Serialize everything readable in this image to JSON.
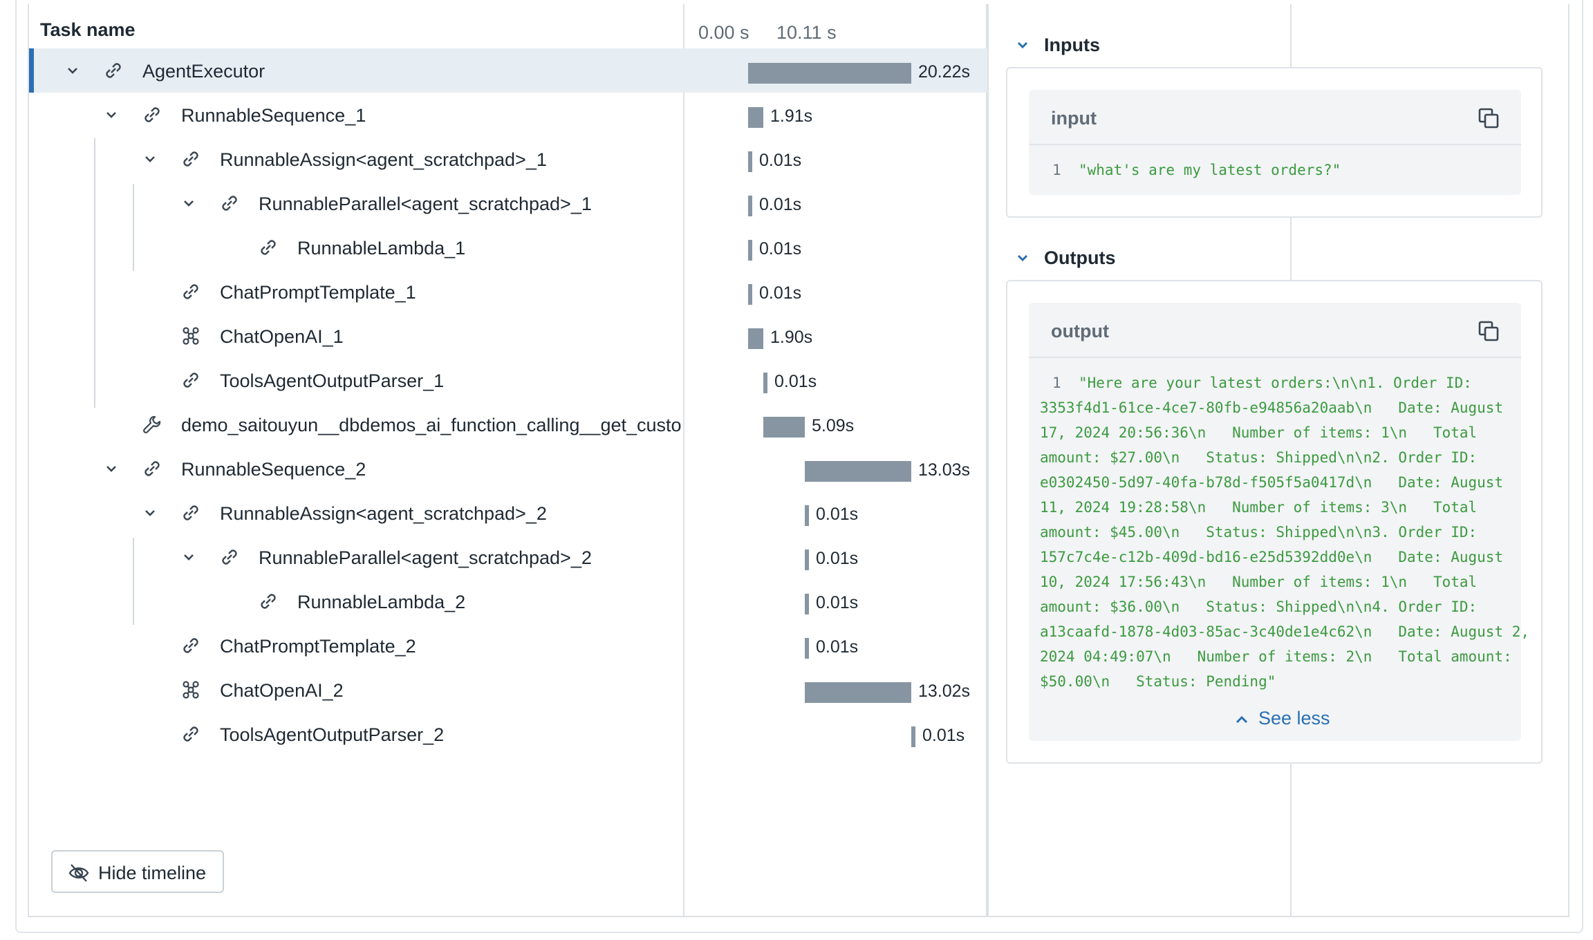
{
  "header": {
    "task_name": "Task name",
    "time_start": "0.00 s",
    "time_mid": "10.11 s"
  },
  "rows": [
    {
      "label": "AgentExecutor",
      "icon": "link-icon",
      "duration": "20.22s"
    },
    {
      "label": "RunnableSequence_1",
      "icon": "link-icon",
      "duration": "1.91s"
    },
    {
      "label": "RunnableAssign<agent_scratchpad>_1",
      "icon": "link-icon",
      "duration": "0.01s"
    },
    {
      "label": "RunnableParallel<agent_scratchpad>_1",
      "icon": "link-icon",
      "duration": "0.01s"
    },
    {
      "label": "RunnableLambda_1",
      "icon": "link-icon",
      "duration": "0.01s"
    },
    {
      "label": "ChatPromptTemplate_1",
      "icon": "link-icon",
      "duration": "0.01s"
    },
    {
      "label": "ChatOpenAI_1",
      "icon": "model-icon",
      "duration": "1.90s"
    },
    {
      "label": "ToolsAgentOutputParser_1",
      "icon": "link-icon",
      "duration": "0.01s"
    },
    {
      "label": "demo_saitouyun__dbdemos_ai_function_calling__get_custo",
      "icon": "wrench-icon",
      "duration": "5.09s"
    },
    {
      "label": "RunnableSequence_2",
      "icon": "link-icon",
      "duration": "13.03s"
    },
    {
      "label": "RunnableAssign<agent_scratchpad>_2",
      "icon": "link-icon",
      "duration": "0.01s"
    },
    {
      "label": "RunnableParallel<agent_scratchpad>_2",
      "icon": "link-icon",
      "duration": "0.01s"
    },
    {
      "label": "RunnableLambda_2",
      "icon": "link-icon",
      "duration": "0.01s"
    },
    {
      "label": "ChatPromptTemplate_2",
      "icon": "link-icon",
      "duration": "0.01s"
    },
    {
      "label": "ChatOpenAI_2",
      "icon": "model-icon",
      "duration": "13.02s"
    },
    {
      "label": "ToolsAgentOutputParser_2",
      "icon": "link-icon",
      "duration": "0.01s"
    }
  ],
  "hide_timeline_label": "Hide timeline",
  "inputs": {
    "title": "Inputs",
    "box_title": "input",
    "line_number": "1",
    "text": "\"what's are my latest orders?\""
  },
  "outputs": {
    "title": "Outputs",
    "box_title": "output",
    "line_number": "1",
    "lines": [
      "\"Here are your latest orders:\\n\\n1. Order ID:",
      "3353f4d1-61ce-4ce7-80fb-e94856a20aab\\n   Date: August",
      "17, 2024 20:56:36\\n   Number of items: 1\\n   Total",
      "amount: $27.00\\n   Status: Shipped\\n\\n2. Order ID:",
      "e0302450-5d97-40fa-b78d-f505f5a0417d\\n   Date: August",
      "11, 2024 19:28:58\\n   Number of items: 3\\n   Total",
      "amount: $45.00\\n   Status: Shipped\\n\\n3. Order ID:",
      "157c7c4e-c12b-409d-bd16-e25d5392dd0e\\n   Date: August",
      "10, 2024 17:56:43\\n   Number of items: 1\\n   Total",
      "amount: $36.00\\n   Status: Shipped\\n\\n4. Order ID:",
      "a13caafd-1878-4d03-85ac-3c40de1e4c62\\n   Date: August 2,",
      "2024 04:49:07\\n   Number of items: 2\\n   Total amount:",
      "$50.00\\n   Status: Pending\""
    ],
    "see_less": "See less"
  }
}
